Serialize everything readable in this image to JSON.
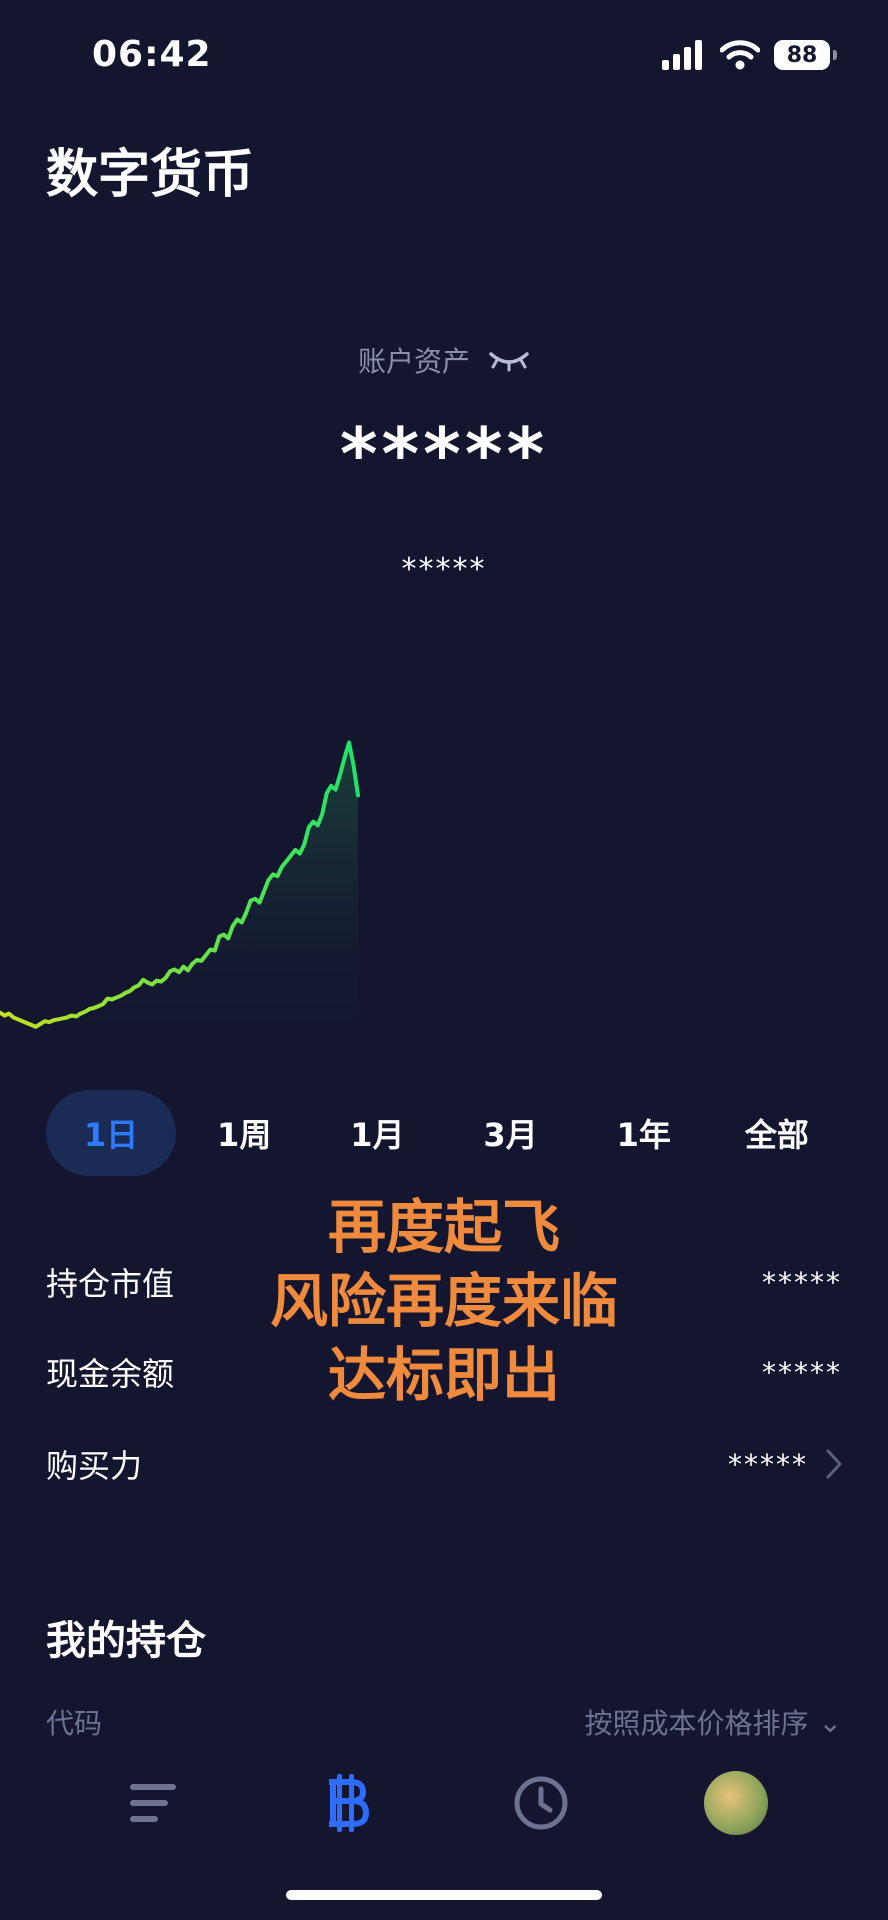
{
  "status": {
    "time": "06:42",
    "battery": "88"
  },
  "page": {
    "title": "数字货币"
  },
  "account": {
    "label": "账户资产",
    "value": "*****",
    "change": "*****"
  },
  "colors": {
    "background": "#141630",
    "accent": "#2e7bff",
    "line_start": "#c6e21f",
    "line_end": "#1ee36a",
    "overlay_text": "#f08a3c"
  },
  "chart_data": {
    "type": "line",
    "x": [
      0,
      1,
      2,
      3,
      4,
      5,
      6,
      7,
      8,
      9,
      10,
      11,
      12,
      13,
      14,
      15,
      16,
      17,
      18,
      19,
      20,
      21,
      22,
      23,
      24,
      25,
      26,
      27,
      28,
      29,
      30,
      31,
      32,
      33,
      34,
      35,
      36,
      37,
      38,
      39,
      40,
      41,
      42,
      43,
      44,
      45,
      46,
      47,
      48,
      49,
      50,
      51,
      52,
      53,
      54,
      55,
      56,
      57,
      58,
      59,
      60,
      61,
      62,
      63,
      64,
      65,
      66,
      67,
      68,
      69,
      70,
      71,
      72,
      73,
      74,
      75,
      76,
      77,
      78,
      79,
      80
    ],
    "values": [
      29,
      26,
      28,
      24,
      22,
      20,
      18,
      16,
      14,
      17,
      20,
      19,
      21,
      22,
      23,
      24,
      26,
      25,
      28,
      30,
      33,
      34,
      36,
      38,
      44,
      43,
      45,
      47,
      50,
      52,
      56,
      58,
      64,
      61,
      59,
      63,
      62,
      66,
      73,
      75,
      72,
      78,
      74,
      81,
      85,
      84,
      90,
      96,
      95,
      110,
      112,
      108,
      121,
      128,
      125,
      135,
      148,
      150,
      146,
      158,
      170,
      176,
      174,
      184,
      190,
      196,
      202,
      198,
      208,
      226,
      232,
      228,
      240,
      262,
      270,
      266,
      282,
      300,
      316,
      292,
      260
    ],
    "ylim": [
      0,
      340
    ]
  },
  "tabs": [
    {
      "label": "1日",
      "active": true
    },
    {
      "label": "1周",
      "active": false
    },
    {
      "label": "1月",
      "active": false
    },
    {
      "label": "3月",
      "active": false
    },
    {
      "label": "1年",
      "active": false
    },
    {
      "label": "全部",
      "active": false
    }
  ],
  "summary": {
    "market_value": {
      "label": "持仓市值",
      "value": "*****"
    },
    "cash_balance": {
      "label": "现金余额",
      "value": "*****"
    },
    "buying_power": {
      "label": "购买力",
      "value": "*****"
    }
  },
  "overlay": {
    "line1": "再度起飞",
    "line2": "风险再度来临",
    "line3": "达标即出"
  },
  "holdings": {
    "title": "我的持仓",
    "col_code": "代码",
    "sort_label": "按照成本价格排序"
  },
  "tabbar": {
    "items": [
      "list-icon",
      "bitcoin-icon",
      "clock-icon",
      "avatar"
    ]
  }
}
